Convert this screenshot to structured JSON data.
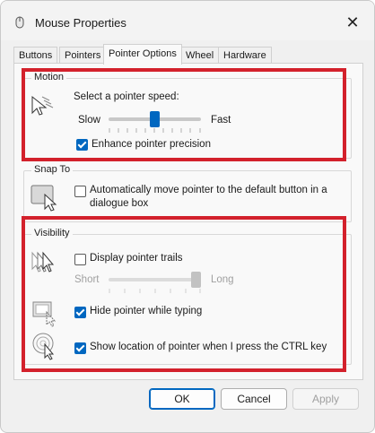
{
  "window": {
    "title": "Mouse Properties",
    "close_icon": "close-icon",
    "app_icon": "mouse-icon"
  },
  "tabs": [
    {
      "label": "Buttons",
      "active": false
    },
    {
      "label": "Pointers",
      "active": false
    },
    {
      "label": "Pointer Options",
      "active": true
    },
    {
      "label": "Wheel",
      "active": false
    },
    {
      "label": "Hardware",
      "active": false
    }
  ],
  "motion": {
    "title": "Motion",
    "speed_label": "Select a pointer speed:",
    "slow_label": "Slow",
    "fast_label": "Fast",
    "speed_fraction": 0.5,
    "enhance_label": "Enhance pointer precision",
    "enhance_checked": true
  },
  "snap": {
    "title": "Snap To",
    "label_line1": "Automatically move pointer to the default button in a",
    "label_line2": "dialogue box",
    "checked": false
  },
  "visibility": {
    "title": "Visibility",
    "trails_label": "Display pointer trails",
    "trails_checked": false,
    "short_label": "Short",
    "long_label": "Long",
    "trails_fraction": 1.0,
    "hide_label": "Hide pointer while typing",
    "hide_checked": true,
    "show_location_label": "Show location of pointer when I press the CTRL key",
    "show_location_checked": true
  },
  "buttons": {
    "ok": "OK",
    "cancel": "Cancel",
    "apply": "Apply"
  },
  "colors": {
    "accent": "#0067c0",
    "highlight_box": "#d3212c"
  }
}
